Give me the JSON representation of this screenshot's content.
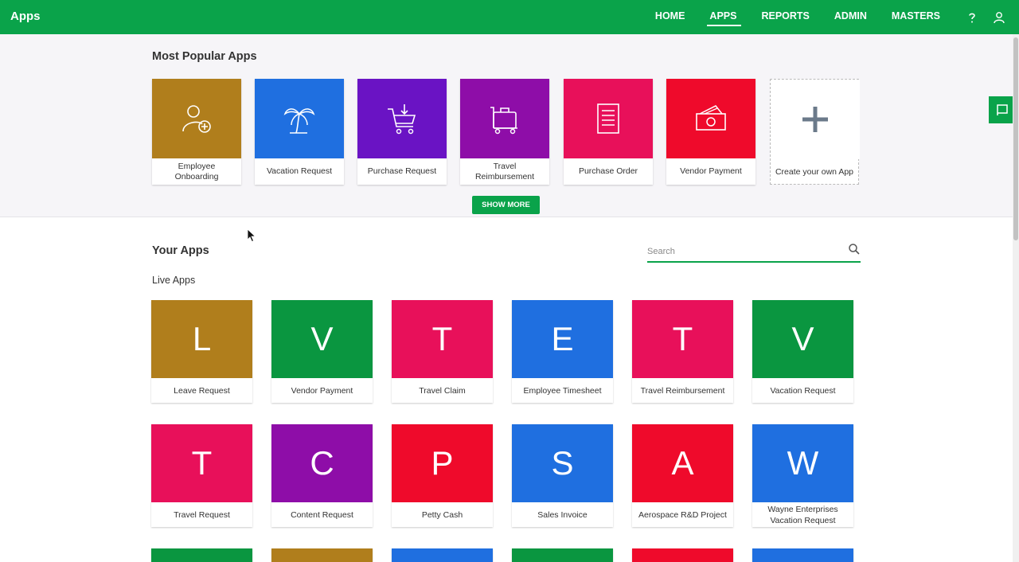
{
  "header": {
    "title": "Apps",
    "nav": [
      "HOME",
      "APPS",
      "REPORTS",
      "ADMIN",
      "MASTERS"
    ],
    "active": "APPS",
    "bg": "#0aa34a"
  },
  "popular": {
    "title": "Most Popular Apps",
    "show_more": "SHOW MORE",
    "tiles": [
      {
        "label": "Employee Onboarding",
        "color": "#b07e1c",
        "icon": "add-user-icon"
      },
      {
        "label": "Vacation Request",
        "color": "#1f6fe0",
        "icon": "palm-tree-icon"
      },
      {
        "label": "Purchase Request",
        "color": "#6a13c4",
        "icon": "shopping-cart-icon"
      },
      {
        "label": "Travel Reimbursement",
        "color": "#8e0da8",
        "icon": "luggage-icon"
      },
      {
        "label": "Purchase Order",
        "color": "#e8105a",
        "icon": "document-list-icon"
      },
      {
        "label": "Vendor Payment",
        "color": "#ef0a2b",
        "icon": "money-icon"
      },
      {
        "label": "Create your own App",
        "color": "#ffffff",
        "icon": "plus-icon"
      }
    ]
  },
  "your_apps": {
    "title": "Your Apps",
    "live_title": "Live Apps",
    "search_placeholder": "Search",
    "tiles": [
      {
        "letter": "L",
        "label": "Leave Request",
        "color": "#b07e1c"
      },
      {
        "letter": "V",
        "label": "Vendor Payment",
        "color": "#0a9640"
      },
      {
        "letter": "T",
        "label": "Travel Claim",
        "color": "#e8105a"
      },
      {
        "letter": "E",
        "label": "Employee Timesheet",
        "color": "#1f6fe0"
      },
      {
        "letter": "T",
        "label": "Travel Reimbursement",
        "color": "#e8105a"
      },
      {
        "letter": "V",
        "label": "Vacation Request",
        "color": "#0a9640"
      },
      {
        "letter": "T",
        "label": "Travel Request",
        "color": "#e8105a"
      },
      {
        "letter": "C",
        "label": "Content Request",
        "color": "#8e0da8"
      },
      {
        "letter": "P",
        "label": "Petty Cash",
        "color": "#ef0a2b"
      },
      {
        "letter": "S",
        "label": "Sales Invoice",
        "color": "#1f6fe0"
      },
      {
        "letter": "A",
        "label": "Aerospace R&D Project",
        "color": "#ef0a2b"
      },
      {
        "letter": "W",
        "label": "Wayne Enterprises Vacation Request",
        "color": "#1f6fe0"
      }
    ],
    "partial_colors": [
      "#0a9640",
      "#b07e1c",
      "#1f6fe0",
      "#0a9640",
      "#ef0a2b",
      "#1f6fe0"
    ]
  }
}
